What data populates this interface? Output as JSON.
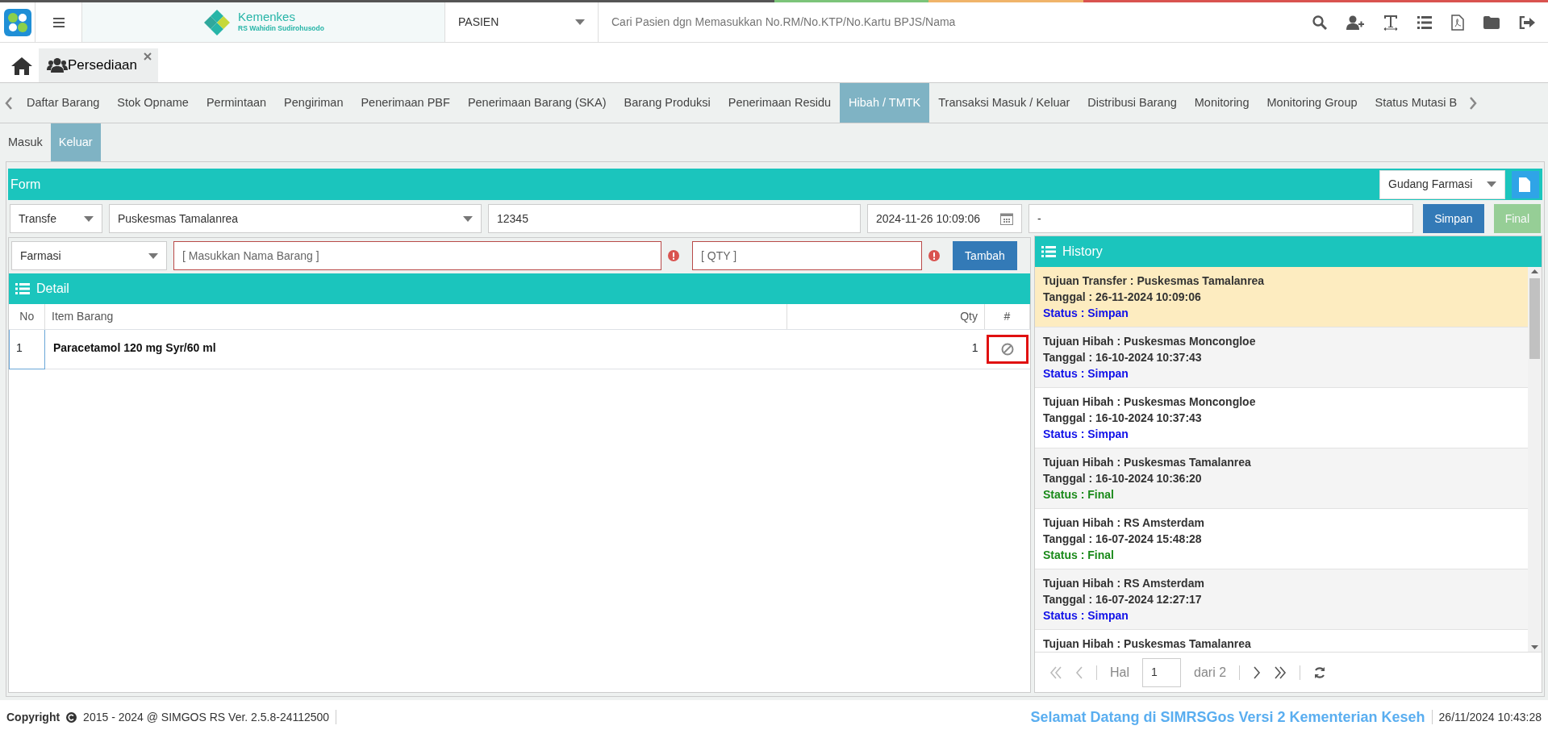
{
  "header": {
    "logo_title": "Kemenkes",
    "logo_subtitle": "RS Wahidin Sudirohusodo",
    "module_select": "PASIEN",
    "search_placeholder": "Cari Pasien dgn Memasukkan No.RM/No.KTP/No.Kartu BPJS/Nama"
  },
  "page_tabs": [
    {
      "label": "Persediaan",
      "selected": true
    }
  ],
  "menu_tabs": [
    {
      "label": "Daftar Barang",
      "selected": false
    },
    {
      "label": "Stok Opname",
      "selected": false
    },
    {
      "label": "Permintaan",
      "selected": false
    },
    {
      "label": "Pengiriman",
      "selected": false
    },
    {
      "label": "Penerimaan PBF",
      "selected": false
    },
    {
      "label": "Penerimaan Barang (SKA)",
      "selected": false
    },
    {
      "label": "Barang Produksi",
      "selected": false
    },
    {
      "label": "Penerimaan Residu",
      "selected": false
    },
    {
      "label": "Hibah / TMTK",
      "selected": true
    },
    {
      "label": "Transaksi Masuk / Keluar",
      "selected": false
    },
    {
      "label": "Distribusi Barang",
      "selected": false
    },
    {
      "label": "Monitoring",
      "selected": false
    },
    {
      "label": "Monitoring Group",
      "selected": false
    },
    {
      "label": "Status Mutasi B",
      "selected": false
    }
  ],
  "sub_tabs": [
    {
      "label": "Masuk",
      "selected": false
    },
    {
      "label": "Keluar",
      "selected": true
    }
  ],
  "form": {
    "title": "Form",
    "warehouse": "Gudang Farmasi",
    "type": "Transfe",
    "destination": "Puskesmas Tamalanrea",
    "number": "12345",
    "datetime": "2024-11-26 10:09:06",
    "note": "-",
    "buttons": [
      {
        "label": "Simpan",
        "disabled": false
      },
      {
        "label": "Final",
        "disabled": true
      }
    ]
  },
  "item_entry": {
    "category": "Farmasi",
    "item_placeholder": "[ Masukkan Nama Barang ]",
    "qty_placeholder": "[ QTY ]",
    "button": "Tambah"
  },
  "detail": {
    "title": "Detail",
    "columns": [
      "No",
      "Item Barang",
      "Qty",
      "#"
    ],
    "rows": [
      {
        "no": "1",
        "item": "Paracetamol 120 mg Syr/60 ml",
        "qty": "1"
      }
    ]
  },
  "history": {
    "title": "History",
    "items": [
      {
        "title": "Tujuan Transfer : Puskesmas Tamalanrea",
        "date": "Tanggal : 26-11-2024 10:09:06",
        "status": "Status : Simpan",
        "kind": "simpan",
        "selected": true
      },
      {
        "title": "Tujuan Hibah : Puskesmas Moncongloe",
        "date": "Tanggal : 16-10-2024 10:37:43",
        "status": "Status : Simpan",
        "kind": "simpan",
        "selected": false
      },
      {
        "title": "Tujuan Hibah : Puskesmas Moncongloe",
        "date": "Tanggal : 16-10-2024 10:37:43",
        "status": "Status : Simpan",
        "kind": "simpan",
        "selected": false
      },
      {
        "title": "Tujuan Hibah : Puskesmas Tamalanrea",
        "date": "Tanggal : 16-10-2024 10:36:20",
        "status": "Status : Final",
        "kind": "final",
        "selected": false
      },
      {
        "title": "Tujuan Hibah : RS Amsterdam",
        "date": "Tanggal : 16-07-2024 15:48:28",
        "status": "Status : Final",
        "kind": "final",
        "selected": false
      },
      {
        "title": "Tujuan Hibah : RS Amsterdam",
        "date": "Tanggal : 16-07-2024 12:27:17",
        "status": "Status : Simpan",
        "kind": "simpan",
        "selected": false
      },
      {
        "title": "Tujuan Hibah : Puskesmas Tamalanrea",
        "selected": false
      }
    ],
    "pager": {
      "label": "Hal",
      "page": "1",
      "of": "dari 2"
    }
  },
  "footer": {
    "copyright": "Copyright",
    "version": "2015 - 2024 @ SIMGOS RS Ver. 2.5.8-24112500",
    "marquee": "Selamat Datang di SIMRSGos Versi 2 Kementerian Keseh",
    "datetime": "26/11/2024 10:43:28"
  }
}
